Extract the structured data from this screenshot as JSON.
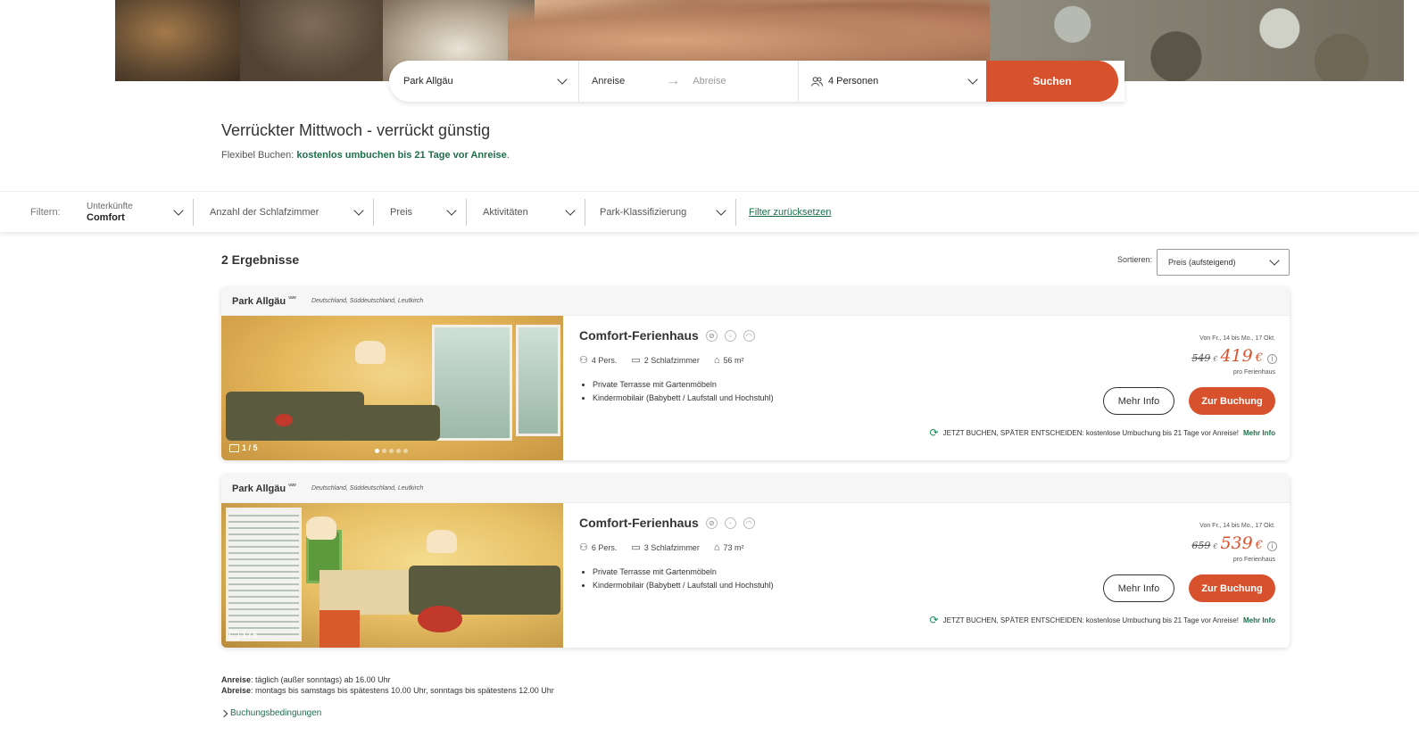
{
  "search": {
    "park": "Park Allgäu",
    "arrival": "Anreise",
    "departure": "Abreise",
    "persons": "4 Personen",
    "submit": "Suchen"
  },
  "headline": {
    "title": "Verrückter Mittwoch - verrückt günstig",
    "flex_prefix": "Flexibel Buchen: ",
    "flex_bold": "kostenlos umbuchen bis 21 Tage vor Anreise",
    "flex_suffix": "."
  },
  "filters": {
    "label": "Filtern:",
    "unterkunft_caption": "Unterkünfte",
    "unterkunft_value": "Comfort",
    "schlafzimmer": "Anzahl der Schlafzimmer",
    "preis": "Preis",
    "aktivitaeten": "Aktivitäten",
    "klassifizierung": "Park-Klassifizierung",
    "reset": "Filter zurücksetzen"
  },
  "results": {
    "count": "2 Ergebnisse",
    "sort_label": "Sortieren:",
    "sort_value": "Preis (aufsteigend)"
  },
  "cards": [
    {
      "park": "Park Allgäu",
      "stars": "ᵛᵛᵛᵛᵛ",
      "location": "Deutschland, Süddeutschland, Leutkirch",
      "image_counter": "1 / 5",
      "title": "Comfort-Ferienhaus",
      "persons": "4 Pers.",
      "bedrooms": "2 Schlafzimmer",
      "area": "56 m²",
      "bullets": [
        "Private Terrasse mit Gartenmöbeln",
        "Kindermobilair (Babybett / Laufstall und Hochstuhl)"
      ],
      "date": "Von Fr., 14 bis Mo., 17 Okt.",
      "old_price": "549",
      "new_price": "419",
      "currency": "€",
      "per": "pro Ferienhaus",
      "more_info": "Mehr Info",
      "book": "Zur Buchung",
      "note": "JETZT BUCHEN, SPÄTER ENTSCHEIDEN: kostenlose Umbuchung bis 21 Tage vor Anreise!",
      "note_link": "Mehr Info"
    },
    {
      "park": "Park Allgäu",
      "stars": "ᵛᵛᵛᵛᵛ",
      "location": "Deutschland, Süddeutschland, Leutkirch",
      "image_counter": "1 / 5",
      "title": "Comfort-Ferienhaus",
      "persons": "6 Pers.",
      "bedrooms": "3 Schlafzimmer",
      "area": "73 m²",
      "bullets": [
        "Private Terrasse mit Gartenmöbeln",
        "Kindermobilair (Babybett / Laufstall und Hochstuhl)"
      ],
      "date": "Von Fr., 14 bis Mo., 17 Okt.",
      "old_price": "659",
      "new_price": "539",
      "currency": "€",
      "per": "pro Ferienhaus",
      "more_info": "Mehr Info",
      "book": "Zur Buchung",
      "note": "JETZT BUCHEN, SPÄTER ENTSCHEIDEN: kostenlose Umbuchung bis 21 Tage vor Anreise!",
      "note_link": "Mehr Info"
    }
  ],
  "footer": {
    "arrival_label": "Anreise",
    "arrival_text": ": täglich (außer sonntags) ab 16.00 Uhr",
    "departure_label": "Abreise",
    "departure_text": ": montags bis samstags bis spätestens 10.00 Uhr, sonntags bis spätestens 12.00 Uhr",
    "conditions": "Buchungsbedingungen"
  },
  "colors": {
    "accent": "#d7512d",
    "green": "#1e6e4a"
  }
}
